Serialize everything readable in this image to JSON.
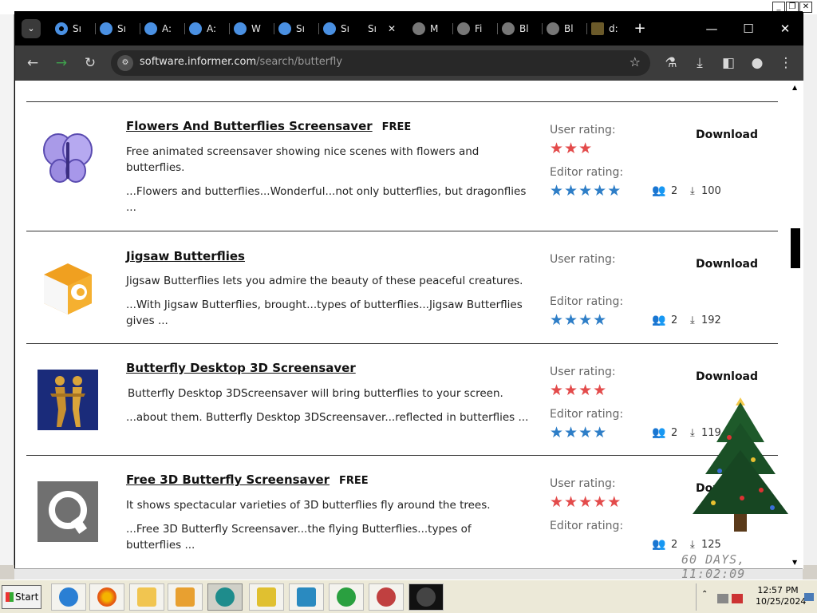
{
  "browser": {
    "tabs": [
      {
        "label": "Sı",
        "icon": "gear-icon"
      },
      {
        "label": "Sı",
        "icon": "a-icon"
      },
      {
        "label": "A:",
        "icon": "a-icon"
      },
      {
        "label": "A:",
        "icon": "a-icon"
      },
      {
        "label": "W",
        "icon": "a-icon"
      },
      {
        "label": "Sı",
        "icon": "a-icon"
      },
      {
        "label": "Sı",
        "icon": "a-icon"
      },
      {
        "label": "Sı",
        "icon": "none"
      },
      {
        "label": "M",
        "icon": "globe-icon"
      },
      {
        "label": "Fi",
        "icon": "globe-icon"
      },
      {
        "label": "Bl",
        "icon": "globe-icon"
      },
      {
        "label": "Bl",
        "icon": "globe-icon"
      },
      {
        "label": "d:",
        "icon": "doc-icon"
      }
    ],
    "tab_close": "✕",
    "tab_menu": "⌄",
    "new_tab": "+",
    "window_controls": {
      "minimize": "—",
      "maximize": "☐",
      "close": "✕"
    },
    "url_host": "software.informer.com",
    "url_path": "/search/butterfly",
    "toolbar": {
      "back": "←",
      "forward": "→",
      "reload": "↻",
      "bookmark": "☆"
    }
  },
  "background_window": {
    "minimize": "_",
    "restore": "❐",
    "close": "✕"
  },
  "labels": {
    "user_rating": "User rating:",
    "editor_rating": "Editor rating:",
    "download": "Download",
    "free": "FREE"
  },
  "results": [
    {
      "title": "Flowers And Butterflies Screensaver",
      "free": true,
      "description": "Free animated screensaver showing nice scenes with flowers and butterflies.",
      "snippet": "...Flowers and butterflies...Wonderful...not only butterflies, but dragonflies ...",
      "user_rating": 3,
      "editor_rating": 5,
      "users": "2",
      "downloads": "100"
    },
    {
      "title": "Jigsaw Butterflies",
      "free": false,
      "description": "Jigsaw Butterflies lets you admire the beauty of these peaceful creatures.",
      "snippet": "...With Jigsaw Butterflies, brought...types of butterflies...Jigsaw Butterflies gives ...",
      "user_rating": 0,
      "editor_rating": 4,
      "users": "2",
      "downloads": "192"
    },
    {
      "title": "Butterfly Desktop 3D Screensaver",
      "free": false,
      "description": "Butterfly Desktop 3DScreensaver will bring butterflies to your screen.",
      "snippet": "...about them. Butterfly Desktop 3DScreensaver...reflected in butterflies ...",
      "user_rating": 4,
      "editor_rating": 4,
      "users": "2",
      "downloads": "119"
    },
    {
      "title": "Free 3D Butterfly Screensaver",
      "free": true,
      "description": "It shows spectacular varieties of 3D butterflies fly around the trees.",
      "snippet": "...Free 3D Butterfly Screensaver...the flying Butterflies...types of butterflies ...",
      "user_rating": 5,
      "editor_rating": 0,
      "users": "2",
      "downloads": "125"
    }
  ],
  "widget": {
    "counter": "60 DAYS, 11:02:09"
  },
  "taskbar": {
    "start": "Start",
    "clock_time": "12:57 PM",
    "clock_date": "10/25/2024"
  },
  "colors": {
    "user_star": "#e34b4b",
    "editor_star": "#2e7ec7",
    "tabstrip": "#000000",
    "toolbar": "#3c3c3c"
  }
}
